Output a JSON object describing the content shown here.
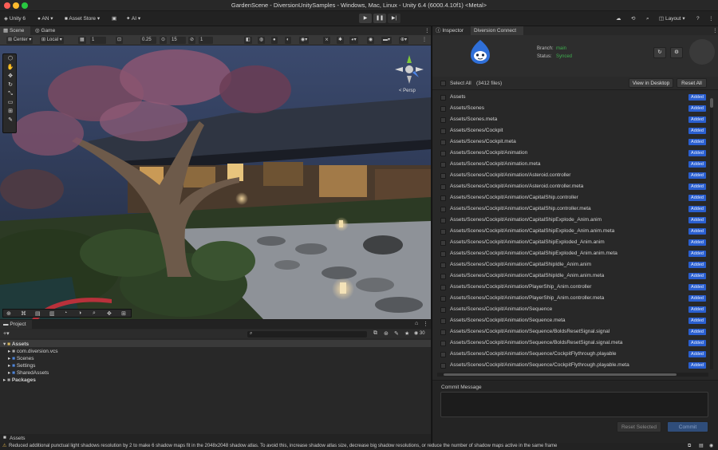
{
  "window": {
    "title": "GardenScene - DiversionUnitySamples - Windows, Mac, Linux - Unity 6.4 (6000.4.10f1) <Metal>"
  },
  "toolbar": {
    "unity_label": "Unity 6",
    "account_label": "AN",
    "asset_store_label": "Asset Store",
    "ai_label": "AI",
    "layout_label": "Layout"
  },
  "left_tabs": {
    "scene": "Scene",
    "game": "Game"
  },
  "scene_bar": {
    "pivot": "Center",
    "space": "Local",
    "grid_value": "1",
    "snap_scale": "0.25",
    "snap_angle": "15",
    "snap_increment": "1"
  },
  "viewport": {
    "persp_label": "< Persp"
  },
  "project": {
    "tab_label": "Project",
    "search_placeholder": "",
    "hidden_count": "30",
    "tree": [
      {
        "label": "Assets",
        "level": 0,
        "expanded": true
      },
      {
        "label": "com.diversion.vcs",
        "level": 1,
        "expanded": false
      },
      {
        "label": "Scenes",
        "level": 1,
        "expanded": false
      },
      {
        "label": "Settings",
        "level": 1,
        "expanded": false
      },
      {
        "label": "SharedAssets",
        "level": 1,
        "expanded": false
      },
      {
        "label": "Packages",
        "level": 0,
        "expanded": false
      }
    ],
    "footer_path": "Assets"
  },
  "right_tabs": {
    "inspector": "Inspector",
    "diversion": "Diversion Connect"
  },
  "diversion": {
    "branch_label": "Branch:",
    "branch_value": "main",
    "status_label": "Status:",
    "status_value": "Synced",
    "select_all_label": "Select All",
    "file_count": "(3412 files)",
    "view_desktop_label": "View in Desktop",
    "reset_all_label": "Reset All",
    "added_badge": "Added",
    "files": [
      "Assets",
      "Assets/Scenes",
      "Assets/Scenes.meta",
      "Assets/Scenes/Cockpit",
      "Assets/Scenes/Cockpit.meta",
      "Assets/Scenes/Cockpit/Animation",
      "Assets/Scenes/Cockpit/Animation.meta",
      "Assets/Scenes/Cockpit/Animation/Asteroid.controller",
      "Assets/Scenes/Cockpit/Animation/Asteroid.controller.meta",
      "Assets/Scenes/Cockpit/Animation/CapitalShip.controller",
      "Assets/Scenes/Cockpit/Animation/CapitalShip.controller.meta",
      "Assets/Scenes/Cockpit/Animation/CapitalShipExplode_Anim.anim",
      "Assets/Scenes/Cockpit/Animation/CapitalShipExplode_Anim.anim.meta",
      "Assets/Scenes/Cockpit/Animation/CapitalShipExploded_Anim.anim",
      "Assets/Scenes/Cockpit/Animation/CapitalShipExploded_Anim.anim.meta",
      "Assets/Scenes/Cockpit/Animation/CapitalShipIdle_Anim.anim",
      "Assets/Scenes/Cockpit/Animation/CapitalShipIdle_Anim.anim.meta",
      "Assets/Scenes/Cockpit/Animation/PlayerShip_Anim.controller",
      "Assets/Scenes/Cockpit/Animation/PlayerShip_Anim.controller.meta",
      "Assets/Scenes/Cockpit/Animation/Sequence",
      "Assets/Scenes/Cockpit/Animation/Sequence.meta",
      "Assets/Scenes/Cockpit/Animation/Sequence/BoldsResetSignal.signal",
      "Assets/Scenes/Cockpit/Animation/Sequence/BoldsResetSignal.signal.meta",
      "Assets/Scenes/Cockpit/Animation/Sequence/CockpitFlythrough.playable",
      "Assets/Scenes/Cockpit/Animation/Sequence/CockpitFlythrough.playable.meta"
    ],
    "commit_label": "Commit Message",
    "commit_placeholder": "",
    "reset_selected_label": "Reset Selected",
    "commit_button_label": "Commit"
  },
  "status_bar": {
    "message": "Reduced additional punctual light shadows resolution by 2 to make 6 shadow maps fit in the 2048x2048 shadow atlas. To avoid this, increase shadow atlas size, decrease big shadow resolutions, or reduce the number of shadow maps active in the same frame"
  },
  "colors": {
    "added_badge": "#2a5fd0",
    "branch_green": "#3fae4f",
    "accent_blue": "#2f6fd8",
    "commit_button": "#2f4d7a"
  }
}
